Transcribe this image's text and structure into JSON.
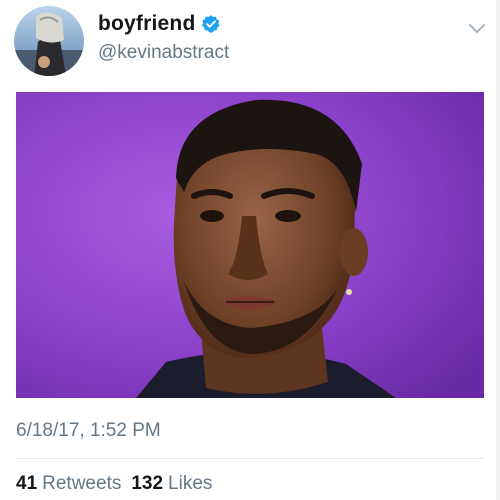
{
  "header": {
    "display_name": "boyfriend",
    "handle": "@kevinabstract",
    "verified_icon": "verified-badge-icon",
    "menu_icon": "chevron-down-icon"
  },
  "media": {
    "description_icon": "photo-media"
  },
  "meta": {
    "timestamp": "6/18/17, 1:52 PM"
  },
  "stats": {
    "retweets_count": "41",
    "retweets_label": "Retweets",
    "likes_count": "132",
    "likes_label": "Likes"
  },
  "colors": {
    "verified_blue": "#1da1f2",
    "secondary_text": "#657786",
    "media_background": "#8a3fc8"
  }
}
